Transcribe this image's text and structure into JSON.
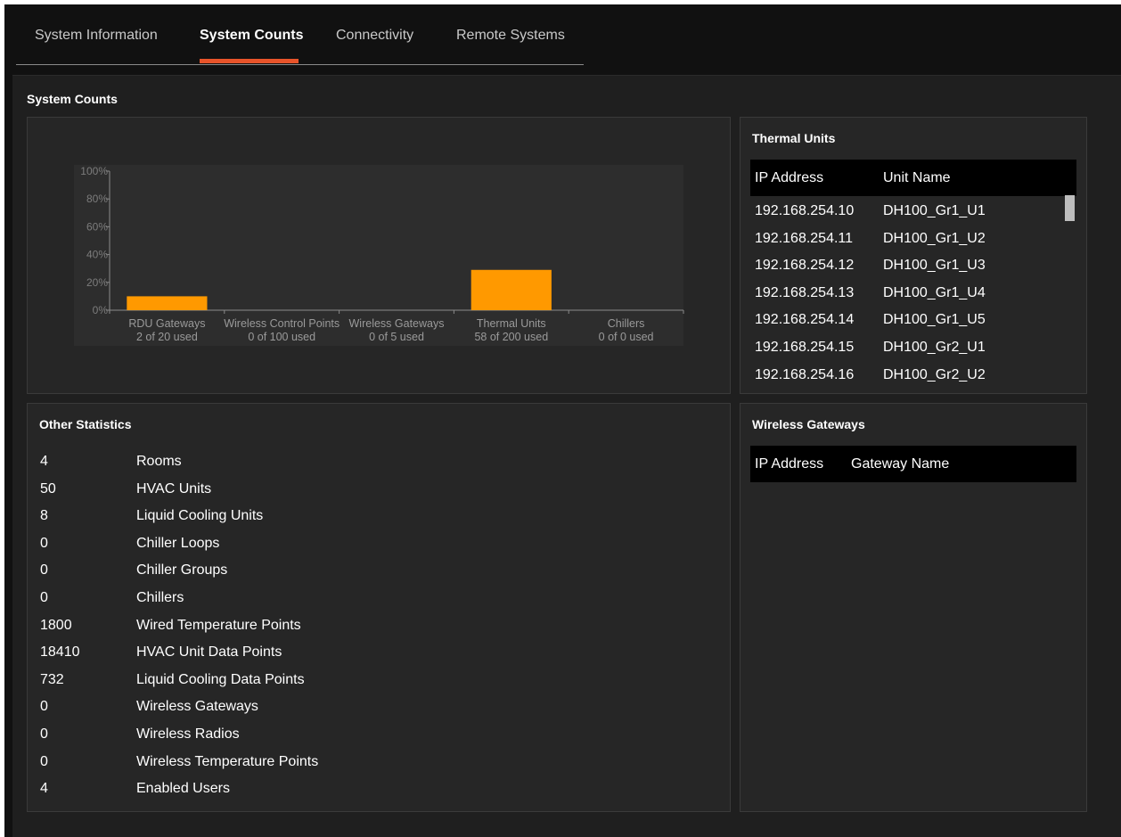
{
  "tabs": [
    {
      "label": "System Information",
      "active": false
    },
    {
      "label": "System Counts",
      "active": true
    },
    {
      "label": "Connectivity",
      "active": false
    },
    {
      "label": "Remote Systems",
      "active": false
    }
  ],
  "main": {
    "title": "System Counts"
  },
  "chart_data": {
    "type": "bar",
    "categories": [
      "RDU Gateways",
      "Wireless Control Points",
      "Wireless Gateways",
      "Thermal Units",
      "Chillers"
    ],
    "sublabels": [
      "2 of 20 used",
      "0 of 100 used",
      "0 of 5 used",
      "58 of 200 used",
      "0 of 0 used"
    ],
    "values": [
      10,
      0,
      0,
      29,
      0
    ],
    "ylim": [
      0,
      100
    ],
    "yticks": [
      "0%",
      "20%",
      "40%",
      "60%",
      "80%",
      "100%"
    ],
    "bar_color": "#ff9900",
    "grid": false
  },
  "thermal_units": {
    "title": "Thermal Units",
    "columns": [
      "IP Address",
      "Unit Name"
    ],
    "rows": [
      [
        "192.168.254.10",
        "DH100_Gr1_U1"
      ],
      [
        "192.168.254.11",
        "DH100_Gr1_U2"
      ],
      [
        "192.168.254.12",
        "DH100_Gr1_U3"
      ],
      [
        "192.168.254.13",
        "DH100_Gr1_U4"
      ],
      [
        "192.168.254.14",
        "DH100_Gr1_U5"
      ],
      [
        "192.168.254.15",
        "DH100_Gr2_U1"
      ],
      [
        "192.168.254.16",
        "DH100_Gr2_U2"
      ]
    ]
  },
  "other_statistics": {
    "title": "Other Statistics",
    "rows": [
      {
        "value": "4",
        "label": "Rooms"
      },
      {
        "value": "50",
        "label": "HVAC Units"
      },
      {
        "value": "8",
        "label": "Liquid Cooling Units"
      },
      {
        "value": "0",
        "label": "Chiller Loops"
      },
      {
        "value": "0",
        "label": "Chiller Groups"
      },
      {
        "value": "0",
        "label": "Chillers"
      },
      {
        "value": "1800",
        "label": "Wired Temperature Points"
      },
      {
        "value": "18410",
        "label": "HVAC Unit Data Points"
      },
      {
        "value": "732",
        "label": "Liquid Cooling Data Points"
      },
      {
        "value": "0",
        "label": "Wireless Gateways"
      },
      {
        "value": "0",
        "label": "Wireless Radios"
      },
      {
        "value": "0",
        "label": "Wireless Temperature Points"
      },
      {
        "value": "4",
        "label": "Enabled Users"
      }
    ]
  },
  "wireless_gateways": {
    "title": "Wireless Gateways",
    "columns": [
      "IP Address",
      "Gateway Name"
    ]
  },
  "colors": {
    "accent": "#e8542a",
    "bar": "#ff9900"
  }
}
